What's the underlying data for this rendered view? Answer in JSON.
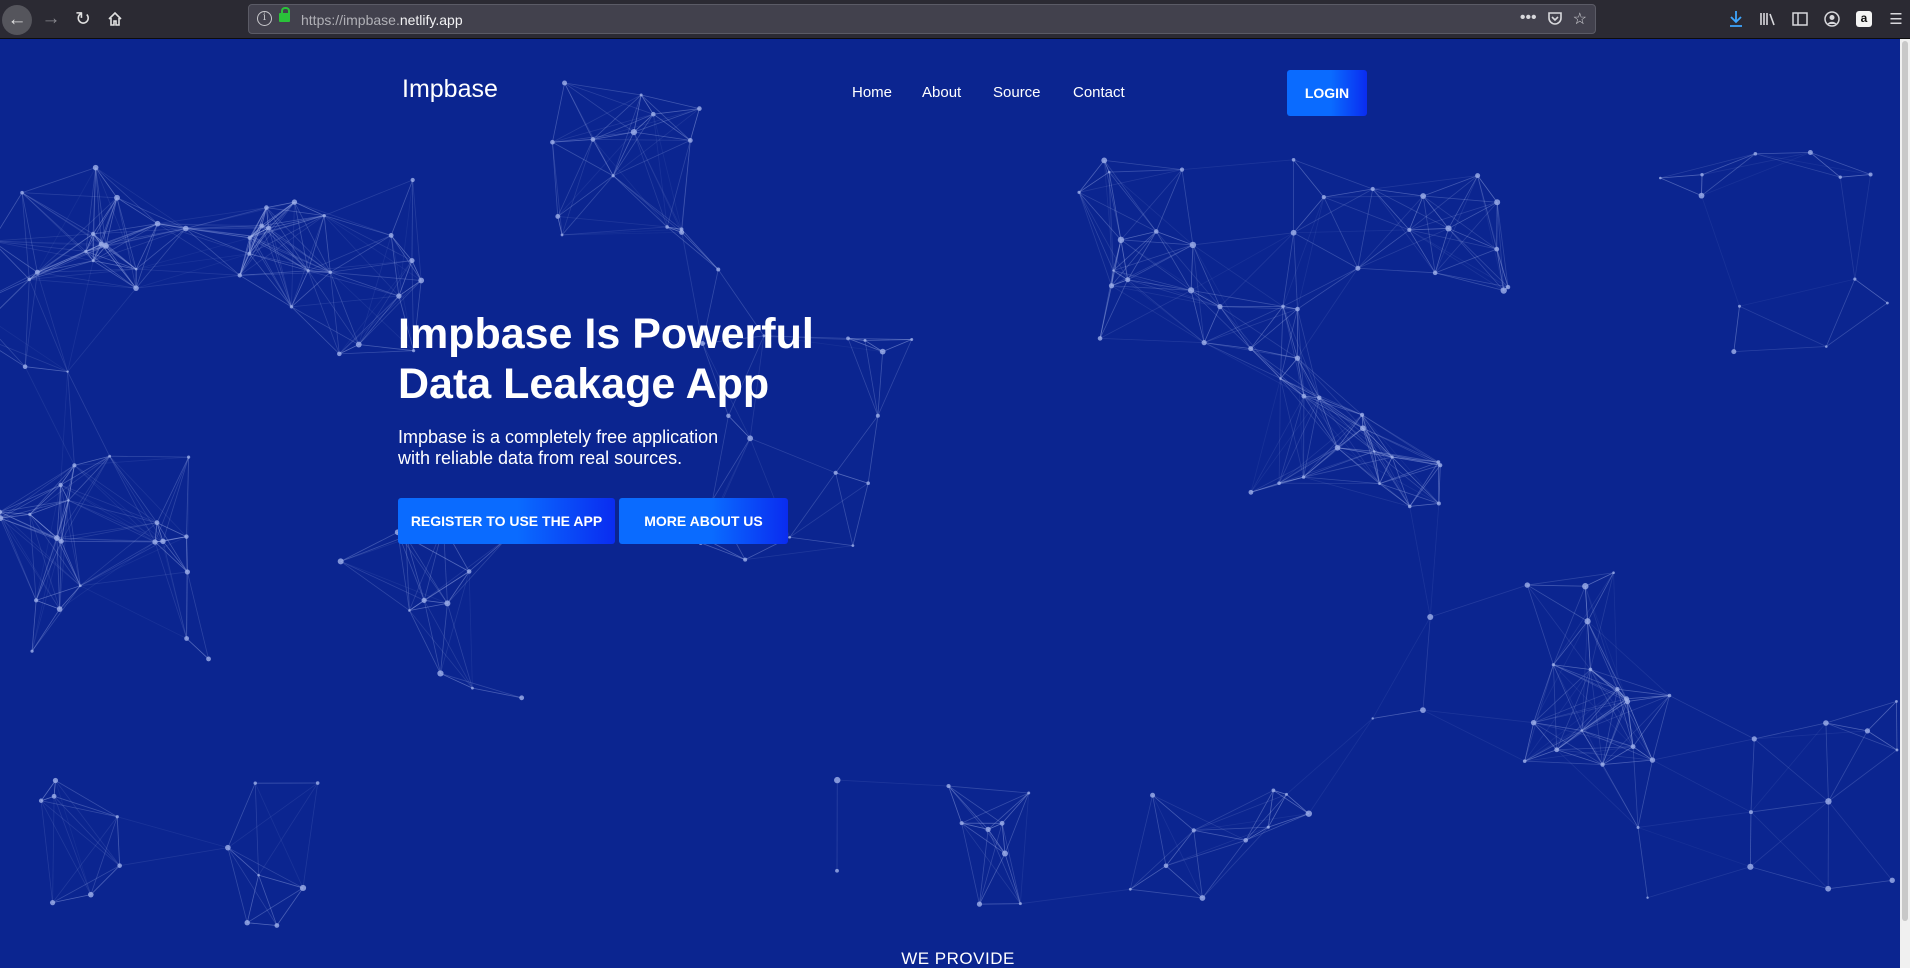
{
  "browser": {
    "url_prefix": "https://impbase.",
    "url_domain": "netlify.app",
    "icons": [
      "back-icon",
      "forward-icon",
      "reload-icon",
      "home-icon",
      "info-icon",
      "lock-icon",
      "more-icon",
      "pocket-icon",
      "bookmark-star-icon",
      "download-icon",
      "library-icon",
      "sidebar-icon",
      "account-icon",
      "amazon-icon",
      "menu-icon"
    ]
  },
  "site": {
    "brand": "Impbase",
    "nav": [
      "Home",
      "About",
      "Source",
      "Contact"
    ],
    "login_label": "LOGIN"
  },
  "hero": {
    "title_line1": "Impbase Is Powerful",
    "title_line2": "Data Leakage App",
    "subtitle_line1": "Impbase is a completely free application",
    "subtitle_line2": "with reliable data from real sources.",
    "register_label": "REGISTER TO USE THE APP",
    "more_label": "MORE ABOUT US"
  },
  "section": {
    "provide_label": "WE PROVIDE"
  },
  "colors": {
    "background": "#0b2590",
    "button_gradient_start": "#0a6bff",
    "button_gradient_end": "#0a2cf0",
    "particle": "#9fb0ea"
  }
}
